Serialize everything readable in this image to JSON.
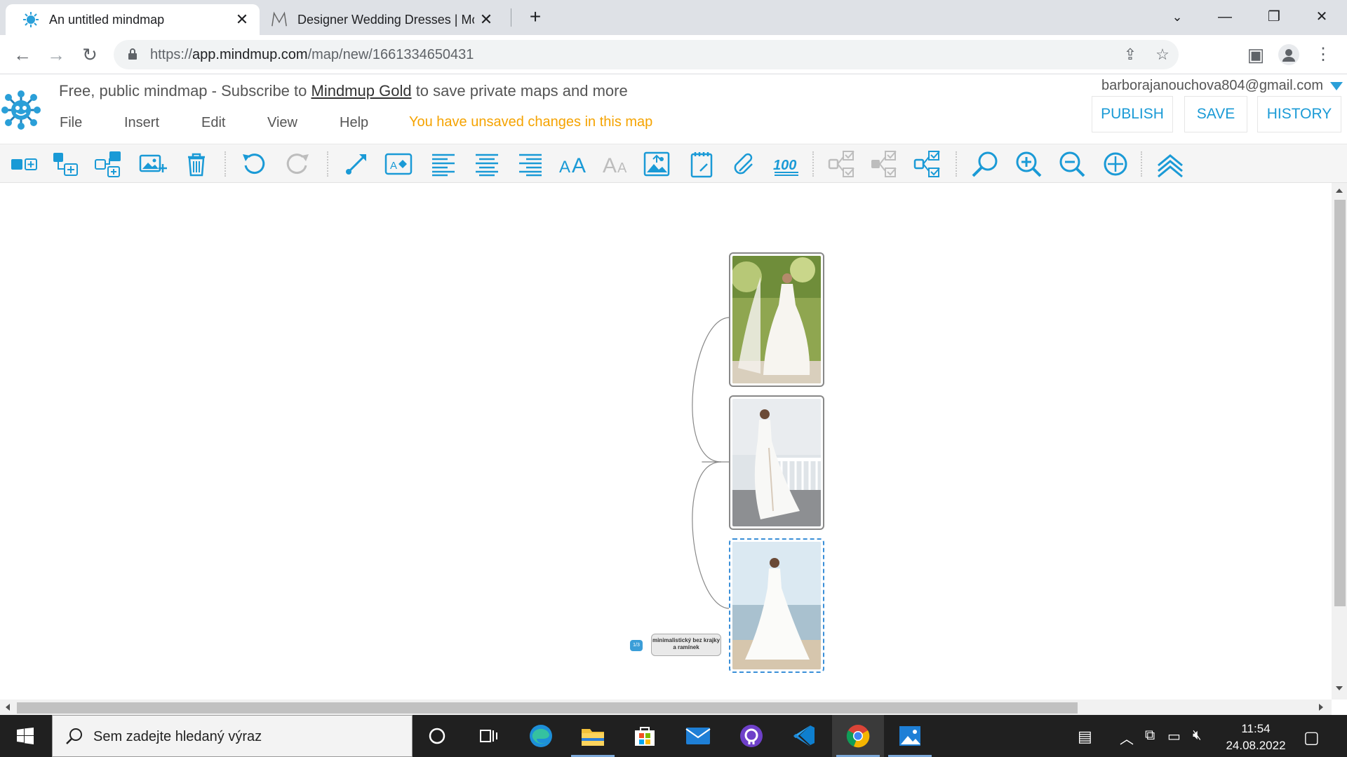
{
  "browser": {
    "tabs": [
      {
        "title": "An untitled mindmap",
        "active": true
      },
      {
        "title": "Designer Wedding Dresses | Mor",
        "active": false
      }
    ],
    "url_prefix": "https://",
    "url_host": "app.mindmup.com",
    "url_path": "/map/new/1661334650431"
  },
  "app": {
    "promo_before": "Free, public mindmap - Subscribe to ",
    "promo_link": "Mindmup Gold",
    "promo_after": " to save private maps and more",
    "menu": [
      "File",
      "Insert",
      "Edit",
      "View",
      "Help"
    ],
    "unsaved_notice": "You have unsaved changes in this map",
    "user_email": "barborajanouchova804@gmail.com",
    "buttons": {
      "publish": "PUBLISH",
      "save": "SAVE",
      "history": "HISTORY"
    },
    "accent": "#1a9ad6",
    "warning_color": "#f5a300"
  },
  "mindmap": {
    "root_label": "minimalistický bez krajky a ramínek",
    "collapse_label": "1/3",
    "image_nodes": 3
  },
  "taskbar": {
    "search_placeholder": "Sem zadejte hledaný výraz",
    "time": "11:54",
    "date": "24.08.2022"
  }
}
